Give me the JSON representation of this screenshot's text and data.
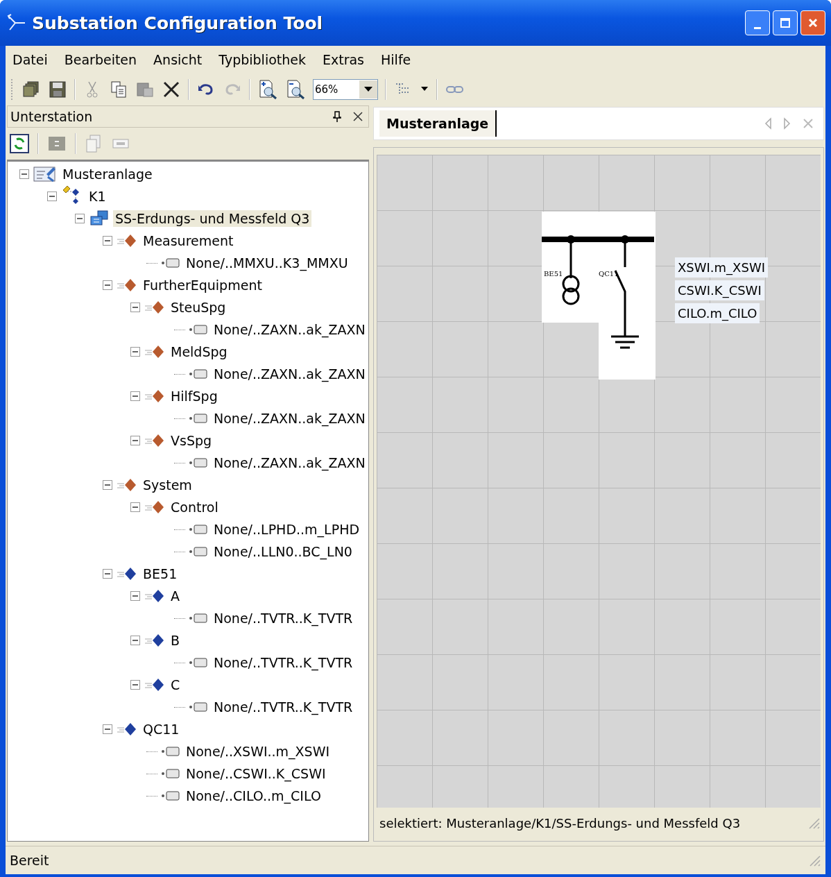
{
  "window": {
    "title": "Substation Configuration Tool"
  },
  "menu": [
    "Datei",
    "Bearbeiten",
    "Ansicht",
    "Typbibliothek",
    "Extras",
    "Hilfe"
  ],
  "toolbar": {
    "zoom": "66%"
  },
  "left_panel": {
    "title": "Unterstation"
  },
  "tree": [
    {
      "label": "Musteranlage",
      "kind": "station",
      "selected": false,
      "expanded": true,
      "children": [
        {
          "label": "K1",
          "kind": "voltage",
          "selected": false,
          "expanded": true,
          "children": [
            {
              "label": "SS-Erdungs- und Messfeld Q3",
              "kind": "bay",
              "selected": true,
              "expanded": true,
              "children": [
                {
                  "label": "Measurement",
                  "kind": "function",
                  "color": "#b85a2e",
                  "selected": false,
                  "expanded": true,
                  "children": [
                    {
                      "label": "None/..MMXU..K3_MMXU",
                      "kind": "lnode",
                      "selected": false
                    }
                  ]
                },
                {
                  "label": "FurtherEquipment",
                  "kind": "function",
                  "color": "#b85a2e",
                  "selected": false,
                  "expanded": true,
                  "children": [
                    {
                      "label": "SteuSpg",
                      "kind": "function",
                      "color": "#b85a2e",
                      "selected": false,
                      "expanded": true,
                      "children": [
                        {
                          "label": "None/..ZAXN..ak_ZAXN",
                          "kind": "lnode",
                          "selected": false
                        }
                      ]
                    },
                    {
                      "label": "MeldSpg",
                      "kind": "function",
                      "color": "#b85a2e",
                      "selected": false,
                      "expanded": true,
                      "children": [
                        {
                          "label": "None/..ZAXN..ak_ZAXN",
                          "kind": "lnode",
                          "selected": false
                        }
                      ]
                    },
                    {
                      "label": "HilfSpg",
                      "kind": "function",
                      "color": "#b85a2e",
                      "selected": false,
                      "expanded": true,
                      "children": [
                        {
                          "label": "None/..ZAXN..ak_ZAXN",
                          "kind": "lnode",
                          "selected": false
                        }
                      ]
                    },
                    {
                      "label": "VsSpg",
                      "kind": "function",
                      "color": "#b85a2e",
                      "selected": false,
                      "expanded": true,
                      "children": [
                        {
                          "label": "None/..ZAXN..ak_ZAXN",
                          "kind": "lnode",
                          "selected": false
                        }
                      ]
                    }
                  ]
                },
                {
                  "label": "System",
                  "kind": "function",
                  "color": "#b85a2e",
                  "selected": false,
                  "expanded": true,
                  "children": [
                    {
                      "label": "Control",
                      "kind": "function",
                      "color": "#b85a2e",
                      "selected": false,
                      "expanded": true,
                      "children": [
                        {
                          "label": "None/..LPHD..m_LPHD",
                          "kind": "lnode",
                          "selected": false
                        },
                        {
                          "label": "None/..LLN0..BC_LN0",
                          "kind": "lnode",
                          "selected": false
                        }
                      ]
                    }
                  ]
                },
                {
                  "label": "BE51",
                  "kind": "function",
                  "color": "#1f3f9e",
                  "selected": false,
                  "expanded": true,
                  "children": [
                    {
                      "label": "A",
                      "kind": "function",
                      "color": "#1f3f9e",
                      "selected": false,
                      "expanded": true,
                      "children": [
                        {
                          "label": "None/..TVTR..K_TVTR",
                          "kind": "lnode",
                          "selected": false
                        }
                      ]
                    },
                    {
                      "label": "B",
                      "kind": "function",
                      "color": "#1f3f9e",
                      "selected": false,
                      "expanded": true,
                      "children": [
                        {
                          "label": "None/..TVTR..K_TVTR",
                          "kind": "lnode",
                          "selected": false
                        }
                      ]
                    },
                    {
                      "label": "C",
                      "kind": "function",
                      "color": "#1f3f9e",
                      "selected": false,
                      "expanded": true,
                      "children": [
                        {
                          "label": "None/..TVTR..K_TVTR",
                          "kind": "lnode",
                          "selected": false
                        }
                      ]
                    }
                  ]
                },
                {
                  "label": "QC11",
                  "kind": "function",
                  "color": "#1f3f9e",
                  "selected": false,
                  "expanded": true,
                  "children": [
                    {
                      "label": "None/..XSWI..m_XSWI",
                      "kind": "lnode",
                      "selected": false
                    },
                    {
                      "label": "None/..CSWI..K_CSWI",
                      "kind": "lnode",
                      "selected": false
                    },
                    {
                      "label": "None/..CILO..m_CILO",
                      "kind": "lnode",
                      "selected": false
                    }
                  ]
                }
              ]
            }
          ]
        }
      ]
    }
  ],
  "tabs": [
    {
      "label": "Musteranlage",
      "selected": true
    }
  ],
  "diagram": {
    "equipment": [
      "BE51",
      "QC11"
    ],
    "nodes": [
      "XSWI.m_XSWI",
      "CSWI.K_CSWI",
      "CILO.m_CILO"
    ]
  },
  "selection_info": "selektiert: Musteranlage/K1/SS-Erdungs- und Messfeld Q3",
  "status_bar": "Bereit"
}
